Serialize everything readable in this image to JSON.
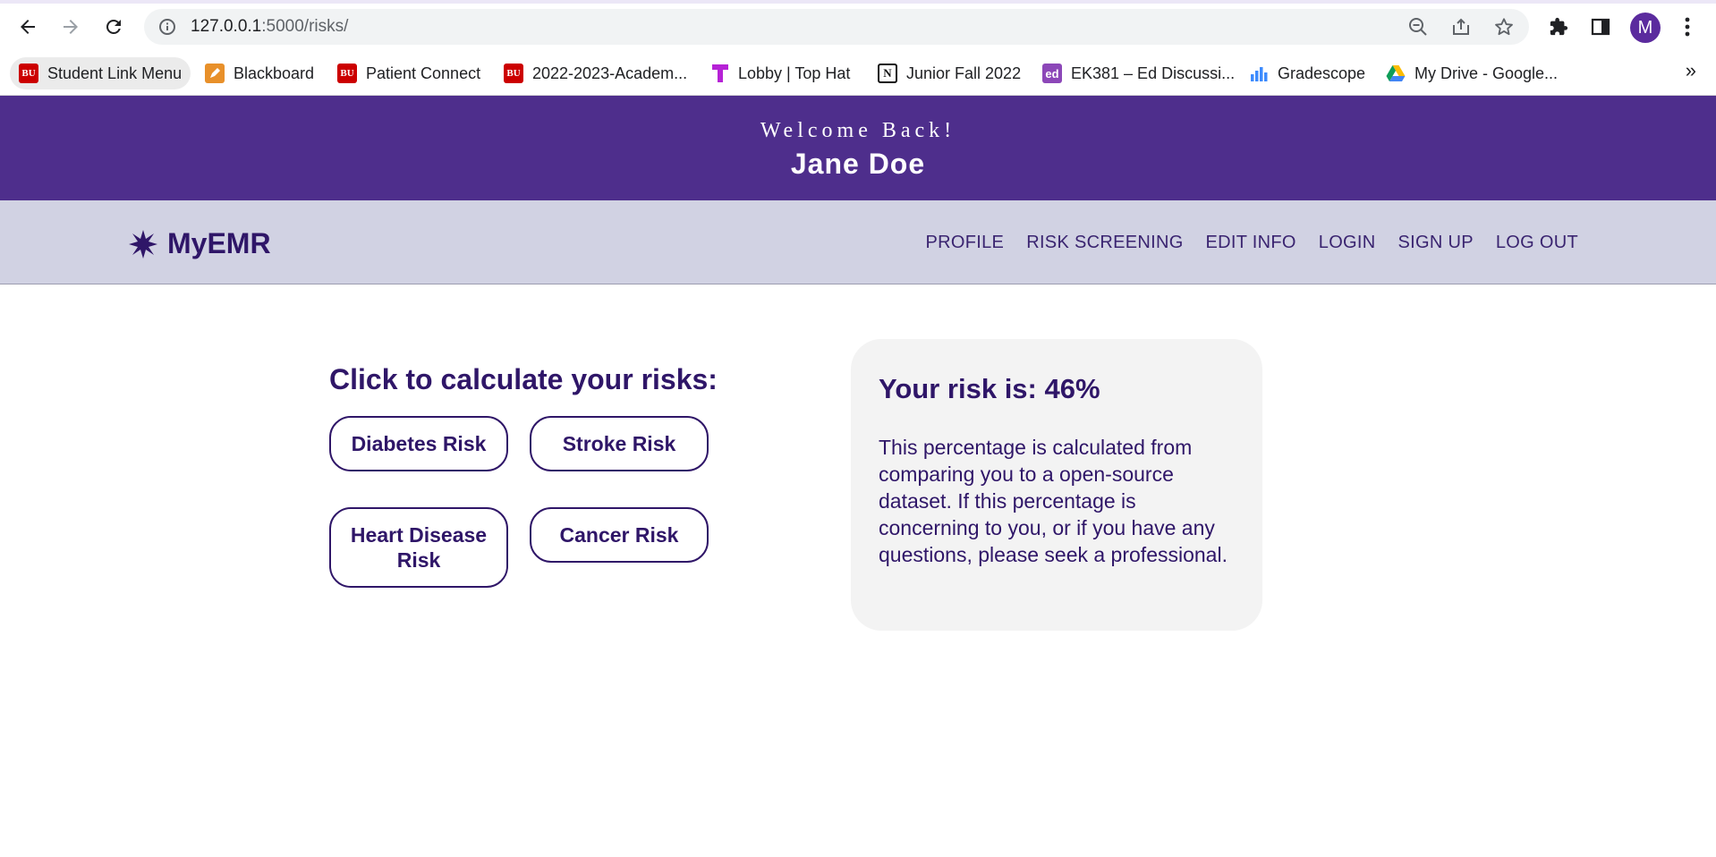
{
  "browser": {
    "url_host": "127.0.0.1",
    "url_path": ":5000/risks/",
    "profile_initial": "M",
    "bookmarks": [
      {
        "label": "Student Link Menu",
        "icon": "bu-logo-icon"
      },
      {
        "label": "Blackboard",
        "icon": "blackboard-icon"
      },
      {
        "label": "Patient Connect",
        "icon": "bu-logo-icon"
      },
      {
        "label": "2022-2023-Academ...",
        "icon": "bu-logo-icon"
      },
      {
        "label": "Lobby | Top Hat",
        "icon": "tophat-icon"
      },
      {
        "label": "Junior Fall 2022",
        "icon": "notion-icon"
      },
      {
        "label": "EK381 – Ed Discussi...",
        "icon": "ed-icon"
      },
      {
        "label": "Gradescope",
        "icon": "gradescope-icon"
      },
      {
        "label": "My Drive - Google...",
        "icon": "google-drive-icon"
      }
    ]
  },
  "banner": {
    "welcome": "Welcome Back!",
    "user_name": "Jane Doe"
  },
  "nav": {
    "brand": "MyEMR",
    "links": [
      "PROFILE",
      "RISK SCREENING",
      "EDIT INFO",
      "LOGIN",
      "SIGN UP",
      "LOG OUT"
    ]
  },
  "risks": {
    "heading": "Click to calculate your risks:",
    "buttons": [
      "Diabetes Risk",
      "Stroke Risk",
      "Heart Disease Risk",
      "Cancer Risk"
    ]
  },
  "result": {
    "title": "Your risk is: 46%",
    "description": "This percentage is calculated from comparing you to a open-source dataset. If this percentage is concerning to you, or if you have any questions, please seek a professional."
  },
  "colors": {
    "banner": "#4e2e8c",
    "nav_bg": "#d1d2e3",
    "primary_text": "#2f1668",
    "card_bg": "#f3f3f3"
  }
}
